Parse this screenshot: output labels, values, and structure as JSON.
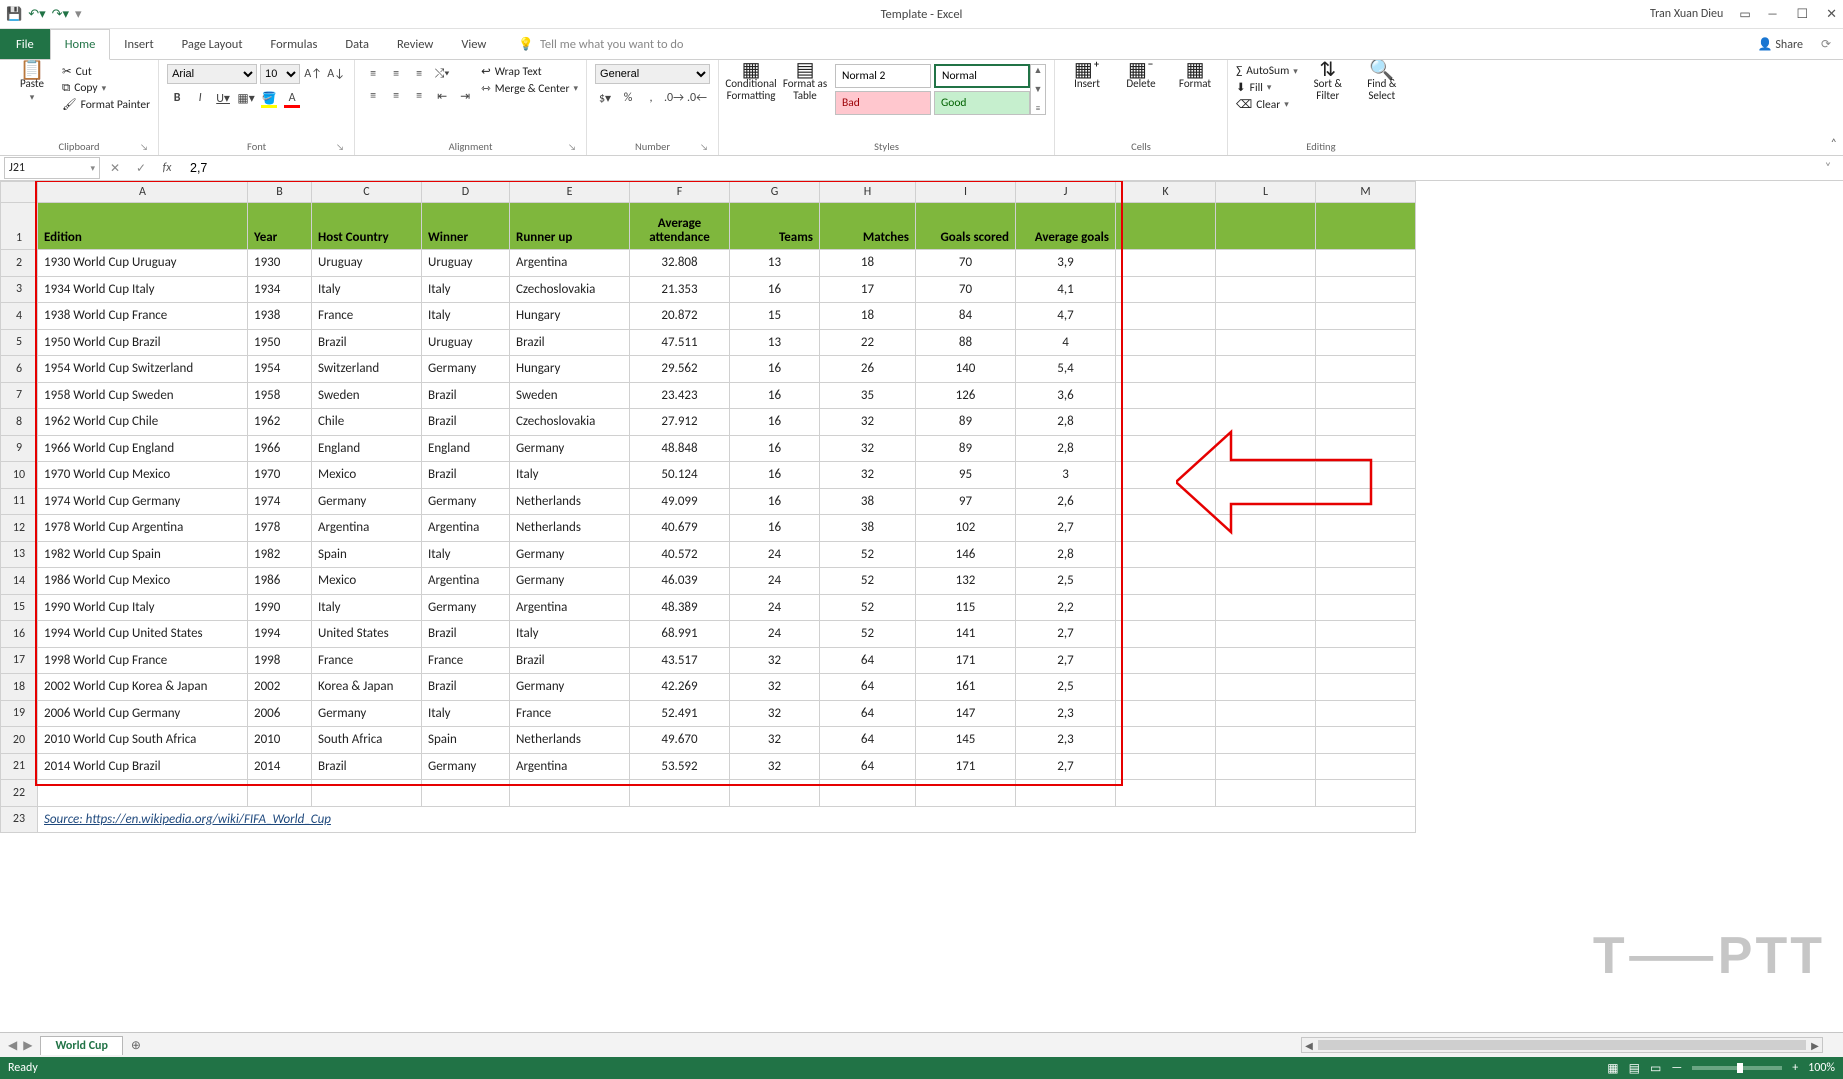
{
  "titlebar": {
    "title": "Template - Excel",
    "user": "Tran Xuan Dieu"
  },
  "tabs": {
    "file": "File",
    "items": [
      "Home",
      "Insert",
      "Page Layout",
      "Formulas",
      "Data",
      "Review",
      "View"
    ],
    "active": "Home",
    "tellme": "Tell me what you want to do",
    "share": "Share"
  },
  "ribbon": {
    "clipboard": {
      "paste": "Paste",
      "cut": "Cut",
      "copy": "Copy",
      "format_painter": "Format Painter",
      "label": "Clipboard"
    },
    "font": {
      "name": "Arial",
      "size": "10",
      "label": "Font"
    },
    "alignment": {
      "wrap": "Wrap Text",
      "merge": "Merge & Center",
      "label": "Alignment"
    },
    "number": {
      "format": "General",
      "label": "Number"
    },
    "styles": {
      "cond": "Conditional Formatting",
      "fat": "Format as Table",
      "cells": {
        "normal2": "Normal 2",
        "normal": "Normal",
        "bad": "Bad",
        "good": "Good"
      },
      "label": "Styles"
    },
    "cells": {
      "insert": "Insert",
      "delete": "Delete",
      "format": "Format",
      "label": "Cells"
    },
    "editing": {
      "autosum": "AutoSum",
      "fill": "Fill",
      "clear": "Clear",
      "sort": "Sort & Filter",
      "find": "Find & Select",
      "label": "Editing"
    }
  },
  "namebox": "J21",
  "formula": "2,7",
  "sheet": {
    "columns": [
      "A",
      "B",
      "C",
      "D",
      "E",
      "F",
      "G",
      "H",
      "I",
      "J",
      "K",
      "L",
      "M"
    ],
    "headers": {
      "edition": "Edition",
      "year": "Year",
      "host": "Host Country",
      "winner": "Winner",
      "runnerup": "Runner up",
      "att": "Average attendance",
      "teams": "Teams",
      "matches": "Matches",
      "goals": "Goals scored",
      "avg": "Average goals"
    },
    "rows": [
      {
        "n": 2,
        "edition": "1930 World Cup Uruguay",
        "year": "1930",
        "host": "Uruguay",
        "winner": "Uruguay",
        "runnerup": "Argentina",
        "att": "32.808",
        "teams": "13",
        "matches": "18",
        "goals": "70",
        "avg": "3,9"
      },
      {
        "n": 3,
        "edition": "1934 World Cup Italy",
        "year": "1934",
        "host": "Italy",
        "winner": "Italy",
        "runnerup": "Czechoslovakia",
        "att": "21.353",
        "teams": "16",
        "matches": "17",
        "goals": "70",
        "avg": "4,1"
      },
      {
        "n": 4,
        "edition": "1938 World Cup France",
        "year": "1938",
        "host": "France",
        "winner": "Italy",
        "runnerup": "Hungary",
        "att": "20.872",
        "teams": "15",
        "matches": "18",
        "goals": "84",
        "avg": "4,7"
      },
      {
        "n": 5,
        "edition": "1950 World Cup Brazil",
        "year": "1950",
        "host": "Brazil",
        "winner": "Uruguay",
        "runnerup": "Brazil",
        "att": "47.511",
        "teams": "13",
        "matches": "22",
        "goals": "88",
        "avg": "4"
      },
      {
        "n": 6,
        "edition": "1954 World Cup Switzerland",
        "year": "1954",
        "host": "Switzerland",
        "winner": "Germany",
        "runnerup": "Hungary",
        "att": "29.562",
        "teams": "16",
        "matches": "26",
        "goals": "140",
        "avg": "5,4"
      },
      {
        "n": 7,
        "edition": "1958 World Cup Sweden",
        "year": "1958",
        "host": "Sweden",
        "winner": "Brazil",
        "runnerup": "Sweden",
        "att": "23.423",
        "teams": "16",
        "matches": "35",
        "goals": "126",
        "avg": "3,6"
      },
      {
        "n": 8,
        "edition": "1962 World Cup Chile",
        "year": "1962",
        "host": "Chile",
        "winner": "Brazil",
        "runnerup": "Czechoslovakia",
        "att": "27.912",
        "teams": "16",
        "matches": "32",
        "goals": "89",
        "avg": "2,8"
      },
      {
        "n": 9,
        "edition": "1966 World Cup England",
        "year": "1966",
        "host": "England",
        "winner": "England",
        "runnerup": "Germany",
        "att": "48.848",
        "teams": "16",
        "matches": "32",
        "goals": "89",
        "avg": "2,8"
      },
      {
        "n": 10,
        "edition": "1970 World Cup Mexico",
        "year": "1970",
        "host": "Mexico",
        "winner": "Brazil",
        "runnerup": "Italy",
        "att": "50.124",
        "teams": "16",
        "matches": "32",
        "goals": "95",
        "avg": "3"
      },
      {
        "n": 11,
        "edition": "1974 World Cup Germany",
        "year": "1974",
        "host": "Germany",
        "winner": "Germany",
        "runnerup": "Netherlands",
        "att": "49.099",
        "teams": "16",
        "matches": "38",
        "goals": "97",
        "avg": "2,6"
      },
      {
        "n": 12,
        "edition": "1978 World Cup Argentina",
        "year": "1978",
        "host": "Argentina",
        "winner": "Argentina",
        "runnerup": "Netherlands",
        "att": "40.679",
        "teams": "16",
        "matches": "38",
        "goals": "102",
        "avg": "2,7"
      },
      {
        "n": 13,
        "edition": "1982 World Cup Spain",
        "year": "1982",
        "host": "Spain",
        "winner": "Italy",
        "runnerup": "Germany",
        "att": "40.572",
        "teams": "24",
        "matches": "52",
        "goals": "146",
        "avg": "2,8"
      },
      {
        "n": 14,
        "edition": "1986 World Cup Mexico",
        "year": "1986",
        "host": "Mexico",
        "winner": "Argentina",
        "runnerup": "Germany",
        "att": "46.039",
        "teams": "24",
        "matches": "52",
        "goals": "132",
        "avg": "2,5"
      },
      {
        "n": 15,
        "edition": "1990 World Cup Italy",
        "year": "1990",
        "host": "Italy",
        "winner": "Germany",
        "runnerup": "Argentina",
        "att": "48.389",
        "teams": "24",
        "matches": "52",
        "goals": "115",
        "avg": "2,2"
      },
      {
        "n": 16,
        "edition": "1994 World Cup United States",
        "year": "1994",
        "host": "United States",
        "winner": "Brazil",
        "runnerup": "Italy",
        "att": "68.991",
        "teams": "24",
        "matches": "52",
        "goals": "141",
        "avg": "2,7"
      },
      {
        "n": 17,
        "edition": "1998 World Cup France",
        "year": "1998",
        "host": "France",
        "winner": "France",
        "runnerup": "Brazil",
        "att": "43.517",
        "teams": "32",
        "matches": "64",
        "goals": "171",
        "avg": "2,7"
      },
      {
        "n": 18,
        "edition": "2002 World Cup Korea & Japan",
        "year": "2002",
        "host": "Korea & Japan",
        "winner": "Brazil",
        "runnerup": "Germany",
        "att": "42.269",
        "teams": "32",
        "matches": "64",
        "goals": "161",
        "avg": "2,5"
      },
      {
        "n": 19,
        "edition": "2006 World Cup Germany",
        "year": "2006",
        "host": "Germany",
        "winner": "Italy",
        "runnerup": "France",
        "att": "52.491",
        "teams": "32",
        "matches": "64",
        "goals": "147",
        "avg": "2,3"
      },
      {
        "n": 20,
        "edition": "2010 World Cup South Africa",
        "year": "2010",
        "host": "South Africa",
        "winner": "Spain",
        "runnerup": "Netherlands",
        "att": "49.670",
        "teams": "32",
        "matches": "64",
        "goals": "145",
        "avg": "2,3"
      },
      {
        "n": 21,
        "edition": "2014 World Cup Brazil",
        "year": "2014",
        "host": "Brazil",
        "winner": "Germany",
        "runnerup": "Argentina",
        "att": "53.592",
        "teams": "32",
        "matches": "64",
        "goals": "171",
        "avg": "2,7"
      }
    ],
    "source_row": {
      "n": 23,
      "text": "Source: https://en.wikipedia.org/wiki/FIFA_World_Cup"
    },
    "row22": 22
  },
  "sheettabs": {
    "active": "World Cup"
  },
  "statusbar": {
    "ready": "Ready",
    "zoom": "100%"
  },
  "watermark": "T⸺PTT"
}
